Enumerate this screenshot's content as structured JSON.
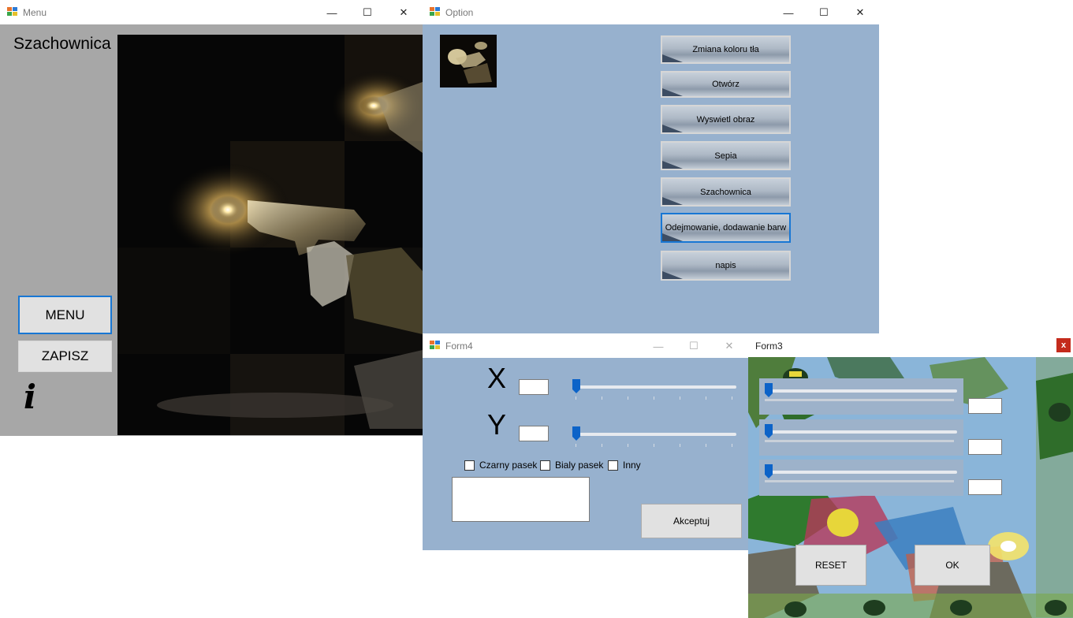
{
  "menu_window": {
    "title": "Menu",
    "heading": "Szachownica",
    "menu_button": "MENU",
    "save_button": "ZAPISZ",
    "info_icon": "i"
  },
  "option_window": {
    "title": "Option",
    "buttons": [
      "Zmiana koloru tła",
      "Otwórz",
      "Wyswietl obraz",
      "Sepia",
      "Szachownica",
      "Odejmowanie, dodawanie barw",
      "napis"
    ]
  },
  "form4_window": {
    "title": "Form4",
    "x_label": "X",
    "y_label": "Y",
    "checkboxes": [
      "Czarny pasek",
      "Bialy pasek",
      "Inny"
    ],
    "accept_button": "Akceptuj"
  },
  "form3_window": {
    "title": "Form3",
    "close_glyph": "x",
    "reset_button": "RESET",
    "ok_button": "OK"
  },
  "window_controls": {
    "minimize": "—",
    "maximize": "☐",
    "close": "✕"
  },
  "colors": {
    "form_bg": "#97b1ce",
    "menu_panel": "#a7a7a7",
    "accent": "#1877d4",
    "form3_close": "#c42b1c"
  }
}
